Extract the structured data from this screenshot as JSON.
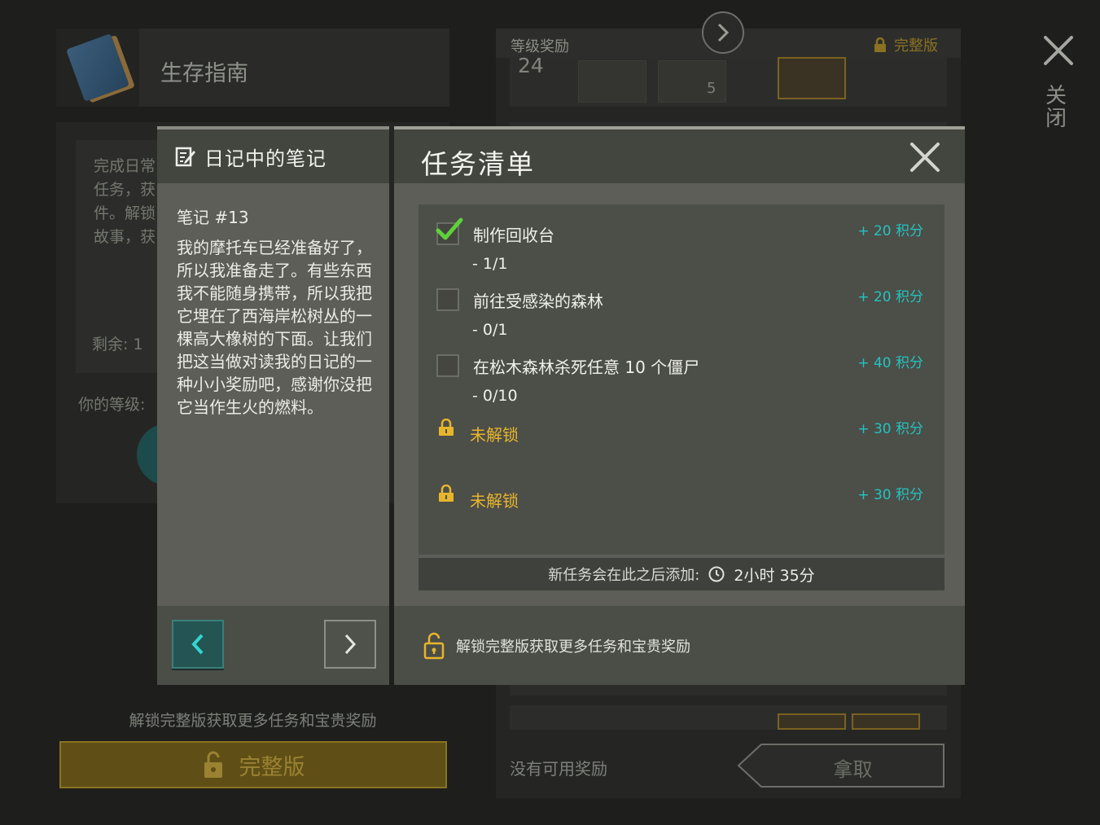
{
  "background": {
    "guide_title": "生存指南",
    "description": "完成日常\n任务，获\n件。解锁\n故事，获",
    "remaining_label": "剩余: 1",
    "level_label": "你的等级:",
    "unlock_note": "解锁完整版获取更多任务和宝贵奖励",
    "full_version_button": "完整版",
    "reward_title": "等级奖励",
    "full_version_badge": "完整版",
    "reward_level": "24",
    "reward_item_count": "5",
    "no_reward_text": "没有可用奖励",
    "claim_button": "拿取",
    "close_label": "关闭"
  },
  "notes": {
    "title": "日记中的笔记",
    "number": "笔记 #13",
    "body": "我的摩托车已经准备好了，所以我准备走了。有些东西我不能随身携带，所以我把它埋在了西海岸松树丛的一棵高大橡树的下面。让我们把这当做对读我的日记的一种小小奖励吧，感谢你没把它当作生火的燃料。"
  },
  "tasks": {
    "title": "任务清单",
    "items": [
      {
        "name": "制作回收台",
        "progress": "- 1/1",
        "points": "+ 20  积分",
        "done": true
      },
      {
        "name": "前往受感染的森林",
        "progress": "- 0/1",
        "points": "+ 20  积分",
        "done": false
      },
      {
        "name": "在松木森林杀死任意 10 个僵尸",
        "progress": "- 0/10",
        "points": "+ 40  积分",
        "done": false
      }
    ],
    "locked": [
      {
        "name": "未解锁",
        "points": "+ 30  积分"
      },
      {
        "name": "未解锁",
        "points": "+ 30  积分"
      }
    ],
    "timer_label": "新任务会在此之后添加:",
    "timer_value": "2小时 35分",
    "footer_text": "解锁完整版获取更多任务和宝贵奖励"
  },
  "colors": {
    "points": "#24c3c0",
    "locked": "#e7b52c",
    "check": "#5fd13a",
    "nav_active": "#245553"
  },
  "icons": [
    "notes-icon",
    "close-icon",
    "check-icon",
    "lock-icon",
    "clock-icon",
    "unlock-icon",
    "chevron-left-icon",
    "chevron-right-icon"
  ]
}
